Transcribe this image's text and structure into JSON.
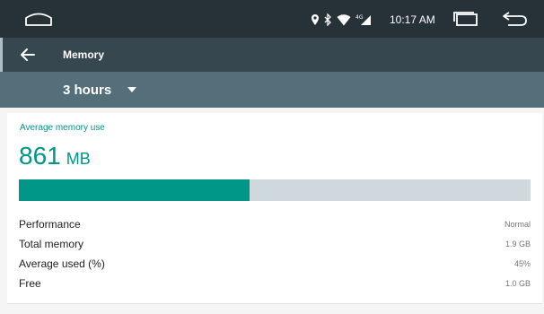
{
  "status_bar": {
    "time": "10:17 AM",
    "icons": [
      "home-icon",
      "location-icon",
      "bluetooth-icon",
      "wifi-icon",
      "signal-icon",
      "recents-icon",
      "back-icon"
    ]
  },
  "app_bar": {
    "title": "Memory",
    "nav_icon": "arrow-back-icon"
  },
  "filter": {
    "period": "3 hours",
    "dropdown_icon": "dropdown-arrow-icon"
  },
  "memory": {
    "avg_label": "Average memory use",
    "avg_value": "861",
    "avg_unit": "MB",
    "usage_fraction": 0.45,
    "stats": [
      {
        "label": "Performance",
        "value": "Normal"
      },
      {
        "label": "Total memory",
        "value": "1.9 GB"
      },
      {
        "label": "Average used (%)",
        "value": "45%"
      },
      {
        "label": "Free",
        "value": "1.0 GB"
      }
    ]
  },
  "colors": {
    "accent": "#009688",
    "status_bar": "#263238",
    "app_bar": "#37474f",
    "filter_bar": "#546e7a",
    "bar_track": "#cfd8dc"
  }
}
